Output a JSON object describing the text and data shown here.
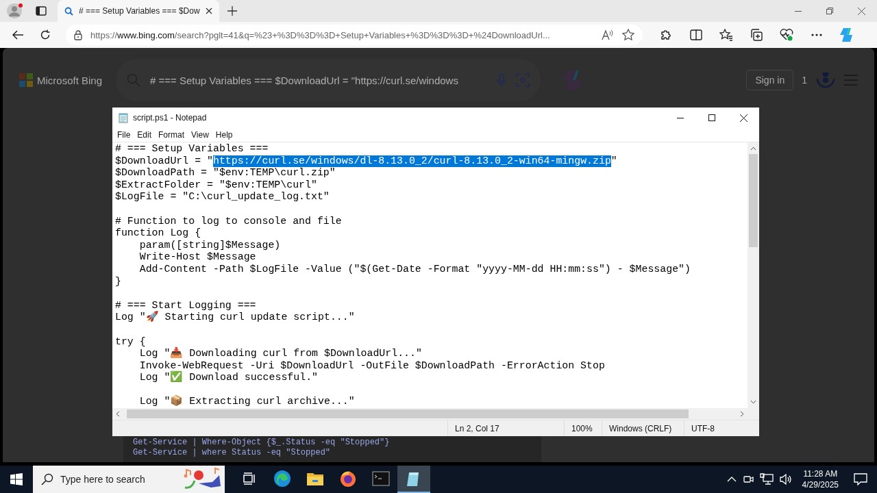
{
  "browser": {
    "tab": {
      "title": "# === Setup Variables === $Dow",
      "selected": true
    },
    "address": {
      "scheme": "https://",
      "host": "www.bing.com",
      "path": "/search?pglt=41&q=%23+%3D%3D%3D+Setup+Variables+%3D%3D%3D+%24DownloadUrl..."
    }
  },
  "bing": {
    "logo": "Microsoft Bing",
    "search_query": "# === Setup Variables === $DownloadUrl = \"https://curl.se/windows",
    "sign_in": "Sign in",
    "rewards_count": "1",
    "code_lines": [
      "Get-Service | Where-Object {$_.Status -eq \"Stopped\"}",
      "Get-Service | where Status -eq \"Stopped\""
    ]
  },
  "notepad": {
    "title": "script.ps1 - Notepad",
    "menu": [
      "File",
      "Edit",
      "Format",
      "View",
      "Help"
    ],
    "lines": [
      {
        "kind": "text",
        "text": "# === Setup Variables ==="
      },
      {
        "kind": "segments",
        "segments": [
          {
            "text": "$DownloadUrl = \"",
            "selected": false
          },
          {
            "text": "https://curl.se/windows/dl-8.13.0_2/curl-8.13.0_2-win64-mingw.zip",
            "selected": true
          },
          {
            "text": "\"",
            "selected": false
          }
        ]
      },
      {
        "kind": "text",
        "text": "$DownloadPath = \"$env:TEMP\\curl.zip\""
      },
      {
        "kind": "text",
        "text": "$ExtractFolder = \"$env:TEMP\\curl\""
      },
      {
        "kind": "text",
        "text": "$LogFile = \"C:\\curl_update_log.txt\""
      },
      {
        "kind": "blank"
      },
      {
        "kind": "text",
        "text": "# Function to log to console and file"
      },
      {
        "kind": "text",
        "text": "function Log {"
      },
      {
        "kind": "text",
        "text": "    param([string]$Message)"
      },
      {
        "kind": "text",
        "text": "    Write-Host $Message"
      },
      {
        "kind": "text",
        "text": "    Add-Content -Path $LogFile -Value (\"$(Get-Date -Format \"yyyy-MM-dd HH:mm:ss\") - $Message\")"
      },
      {
        "kind": "text",
        "text": "}"
      },
      {
        "kind": "blank"
      },
      {
        "kind": "text",
        "text": "# === Start Logging ==="
      },
      {
        "kind": "text",
        "text": "Log \"🚀 Starting curl update script...\""
      },
      {
        "kind": "blank"
      },
      {
        "kind": "text",
        "text": "try {"
      },
      {
        "kind": "text",
        "text": "    Log \"📥 Downloading curl from $DownloadUrl...\""
      },
      {
        "kind": "text",
        "text": "    Invoke-WebRequest -Uri $DownloadUrl -OutFile $DownloadPath -ErrorAction Stop"
      },
      {
        "kind": "text",
        "text": "    Log \"✅ Download successful.\""
      },
      {
        "kind": "blank"
      },
      {
        "kind": "text",
        "text": "    Log \"📦 Extracting curl archive...\""
      }
    ],
    "status_bar": [
      "Ln 2, Col 17",
      "100%",
      "Windows (CRLF)",
      "UTF-8"
    ]
  },
  "taskbar": {
    "search_placeholder": "Type here to search",
    "apps": [
      {
        "kind": "edge",
        "selected": false
      },
      {
        "kind": "explorer",
        "selected": false
      },
      {
        "kind": "firefox",
        "selected": false
      },
      {
        "kind": "terminal",
        "selected": false
      },
      {
        "kind": "notepad",
        "selected": true
      }
    ],
    "time": "11:28 AM",
    "date": "4/29/2025"
  }
}
